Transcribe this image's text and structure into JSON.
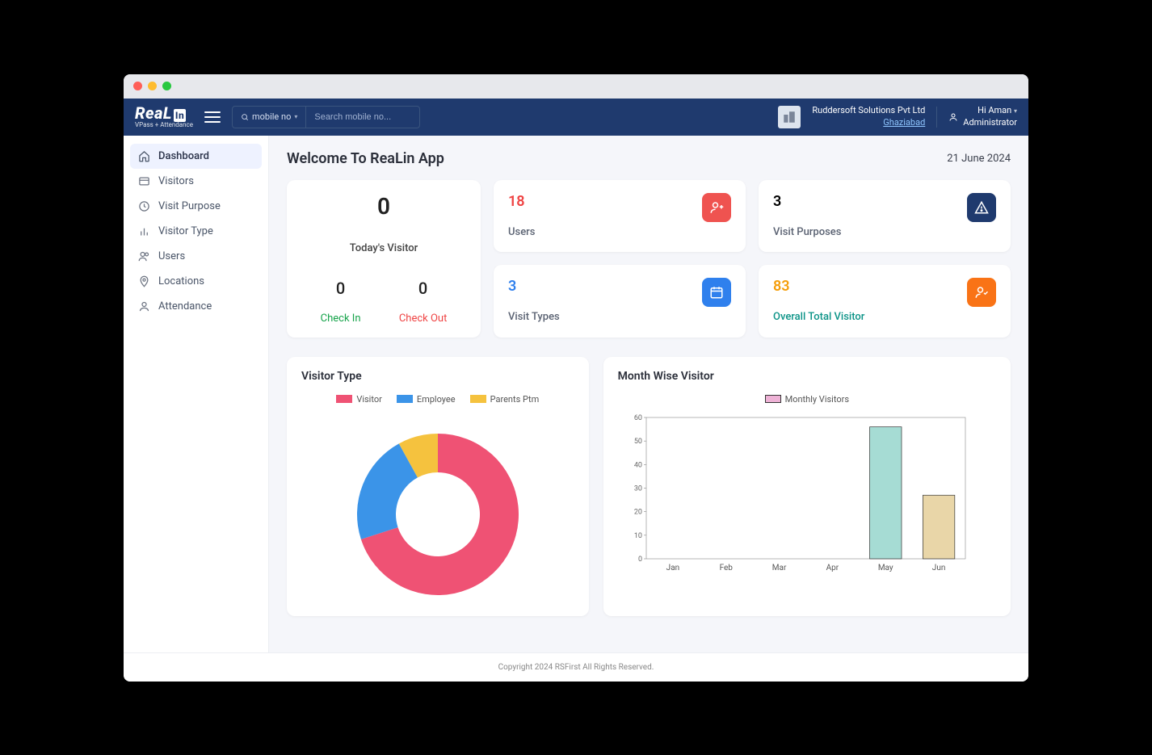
{
  "header": {
    "logo": "ReaL",
    "logo_sub": "VPass + Attendance",
    "search_mode": "mobile no",
    "search_placeholder": "Search mobile no...",
    "org_name": "Ruddersoft Solutions Pvt Ltd",
    "org_location": "Ghaziabad",
    "user_greeting": "Hi Aman",
    "user_role": "Administrator"
  },
  "sidebar": {
    "items": [
      {
        "label": "Dashboard",
        "icon": "home",
        "active": true
      },
      {
        "label": "Visitors",
        "icon": "card",
        "active": false
      },
      {
        "label": "Visit Purpose",
        "icon": "clock",
        "active": false
      },
      {
        "label": "Visitor Type",
        "icon": "bars",
        "active": false
      },
      {
        "label": "Users",
        "icon": "users",
        "active": false
      },
      {
        "label": "Locations",
        "icon": "pin",
        "active": false
      },
      {
        "label": "Attendance",
        "icon": "person",
        "active": false
      }
    ]
  },
  "page": {
    "title": "Welcome To ReaLin App",
    "date": "21 June 2024"
  },
  "today_card": {
    "value": "0",
    "label": "Today's Visitor",
    "checkin_value": "0",
    "checkin_label": "Check In",
    "checkout_value": "0",
    "checkout_label": "Check Out"
  },
  "stat_cards": [
    {
      "value": "18",
      "label": "Users",
      "color": "c-red",
      "icon_bg": "bg-red",
      "icon": "user-plus"
    },
    {
      "value": "3",
      "label": "Visit Purposes",
      "color": "",
      "icon_bg": "bg-navy",
      "icon": "warning"
    },
    {
      "value": "3",
      "label": "Visit Types",
      "color": "c-blue",
      "icon_bg": "bg-blue",
      "icon": "calendar"
    },
    {
      "value": "83",
      "label": "Overall Total Visitor",
      "color": "c-orange",
      "label_color": "c-teal",
      "icon_bg": "bg-orange",
      "icon": "user-check"
    }
  ],
  "charts": {
    "donut": {
      "title": "Visitor Type",
      "legend": [
        "Visitor",
        "Employee",
        "Parents Ptm"
      ],
      "colors": [
        "#ef5274",
        "#3b94e8",
        "#f5c23e"
      ]
    },
    "bar": {
      "title": "Month Wise Visitor",
      "legend": "Monthly Visitors"
    }
  },
  "footer": "Copyright 2024 RSFirst All Rights Reserved.",
  "chart_data": [
    {
      "type": "pie",
      "title": "Visitor Type",
      "series": [
        {
          "name": "Visitor",
          "value": 70,
          "color": "#ef5274"
        },
        {
          "name": "Employee",
          "value": 22,
          "color": "#3b94e8"
        },
        {
          "name": "Parents Ptm",
          "value": 8,
          "color": "#f5c23e"
        }
      ]
    },
    {
      "type": "bar",
      "title": "Month Wise Visitor",
      "xlabel": "",
      "ylabel": "",
      "ylim": [
        0,
        60
      ],
      "categories": [
        "Jan",
        "Feb",
        "Mar",
        "Apr",
        "May",
        "Jun"
      ],
      "series": [
        {
          "name": "Monthly Visitors",
          "values": [
            0,
            0,
            0,
            0,
            56,
            27
          ],
          "color": "#a6dcd4"
        }
      ]
    }
  ]
}
